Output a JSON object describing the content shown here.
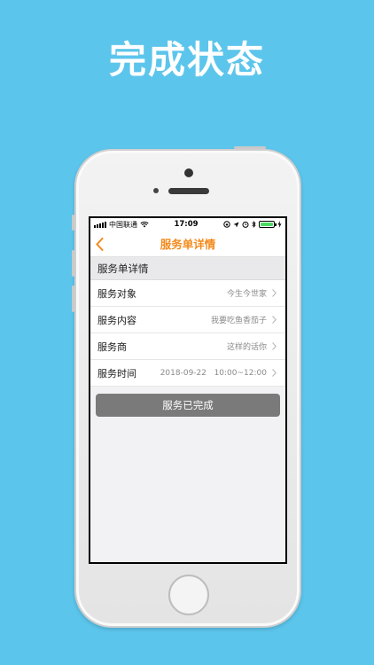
{
  "headline": "完成状态",
  "status_bar": {
    "carrier": "中国联通",
    "time": "17:09",
    "icons": [
      "signal-icon",
      "wifi-icon",
      "lock-rotation-icon",
      "location-icon",
      "alarm-icon",
      "bluetooth-icon",
      "battery-icon",
      "charging-icon"
    ]
  },
  "nav": {
    "title": "服务单详情",
    "back_icon": "chevron-left-icon",
    "accent_color": "#f28a1c"
  },
  "section": {
    "title": "服务单详情"
  },
  "rows": [
    {
      "label": "服务对象",
      "value": "今生今世家"
    },
    {
      "label": "服务内容",
      "value": "我要吃鱼香茄子"
    },
    {
      "label": "服务商",
      "value": "这样的话你"
    },
    {
      "label": "服务时间",
      "value": "2018-09-22   10:00~12:00"
    }
  ],
  "action_button": {
    "label": "服务已完成",
    "state": "disabled"
  },
  "colors": {
    "background": "#5cc5ec",
    "button_gray": "#7a7a7a"
  }
}
